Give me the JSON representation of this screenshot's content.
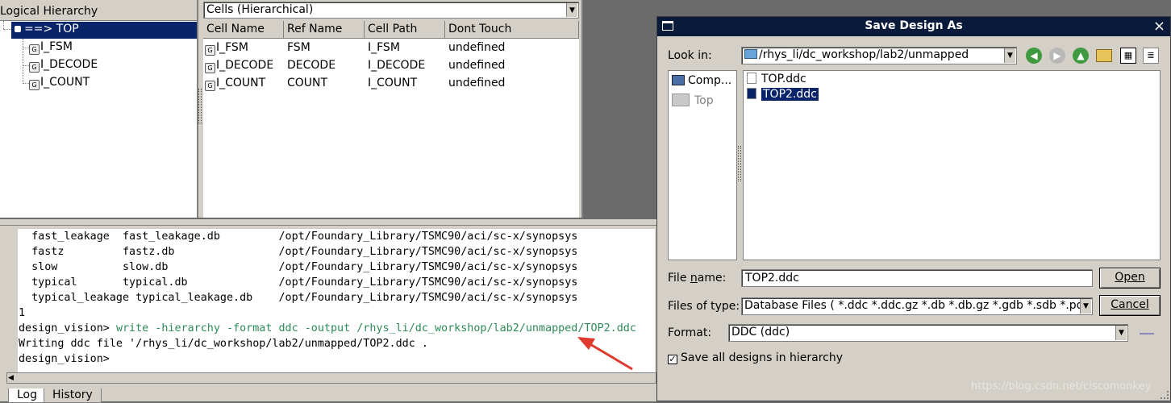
{
  "hierarchy": {
    "title": "Logical Hierarchy",
    "items": [
      {
        "label": "==> TOP",
        "selected": true
      },
      {
        "label": "I_FSM"
      },
      {
        "label": "I_DECODE"
      },
      {
        "label": "I_COUNT"
      }
    ]
  },
  "cells": {
    "view_select": "Cells (Hierarchical)",
    "columns": [
      "Cell Name",
      "Ref Name",
      "Cell Path",
      "Dont Touch"
    ],
    "rows": [
      [
        "I_FSM",
        "FSM",
        "I_FSM",
        "undefined"
      ],
      [
        "I_DECODE",
        "DECODE",
        "I_DECODE",
        "undefined"
      ],
      [
        "I_COUNT",
        "COUNT",
        "I_COUNT",
        "undefined"
      ]
    ]
  },
  "console": {
    "lines": [
      "  fast_leakage  fast_leakage.db         /opt/Foundary_Library/TSMC90/aci/sc-x/synopsys",
      "  fastz         fastz.db                /opt/Foundary_Library/TSMC90/aci/sc-x/synopsys",
      "  slow          slow.db                 /opt/Foundary_Library/TSMC90/aci/sc-x/synopsys",
      "  typical       typical.db              /opt/Foundary_Library/TSMC90/aci/sc-x/synopsys",
      "  typical_leakage typical_leakage.db    /opt/Foundary_Library/TSMC90/aci/sc-x/synopsys",
      "1"
    ],
    "prompt": "design_vision> ",
    "command": "write -hierarchy -format ddc -output /rhys_li/dc_workshop/lab2/unmapped/TOP2.ddc",
    "output": "Writing ddc file '/rhys_li/dc_workshop/lab2/unmapped/TOP2.ddc .",
    "last_prompt": "design_vision>",
    "command_color": "#2e8b57",
    "arrow_color": "#e03a2e"
  },
  "tabs": [
    "Log",
    "History"
  ],
  "dialog": {
    "title": "Save Design As",
    "close": "×",
    "look_in_label": "Look in:",
    "look_in_value": "/rhys_li/dc_workshop/lab2/unmapped",
    "sidebar": [
      {
        "label": "Comp..."
      },
      {
        "label": "Top"
      }
    ],
    "files": [
      {
        "name": "TOP.ddc",
        "selected": false
      },
      {
        "name": "TOP2.ddc",
        "selected": true
      }
    ],
    "file_name_label": "File name:",
    "file_name_value": "TOP2.ddc",
    "files_of_type_label": "Files of type:",
    "files_of_type_value": "Database Files ( *.ddc *.ddc.gz *.db *.db.gz *.gdb *.sdb *.pdb",
    "format_label": "Format:",
    "format_value": "DDC (ddc)",
    "save_all_label": "Save all designs in hierarchy",
    "save_all_checked": true,
    "open_button": "Open",
    "cancel_button": "Cancel",
    "title_bar_color": "#0a1a3a"
  },
  "watermark": "https://blog.csdn.net/ciscomonkey"
}
